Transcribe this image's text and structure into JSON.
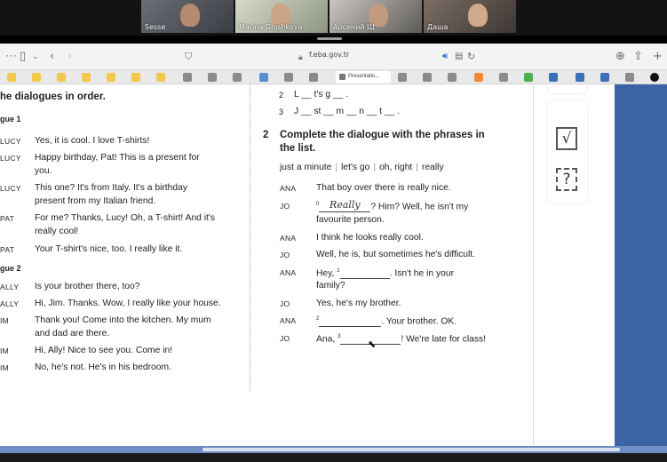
{
  "video": {
    "participants": [
      {
        "name": "Sesse"
      },
      {
        "name": "Marina Glushkova"
      },
      {
        "name": "Арсений Щ"
      },
      {
        "name": "Даша"
      }
    ]
  },
  "browser": {
    "address": "f.eba.gov.tr",
    "active_tab": "Presentatio..."
  },
  "left": {
    "heading": "he dialogues in order.",
    "dialogue1_label": "gue 1",
    "dialogue1": [
      {
        "speaker": "LUCY",
        "text": "Yes, it is cool. I love T-shirts!"
      },
      {
        "speaker": "LUCY",
        "text": "Happy birthday, Pat! This is a present for",
        "text2": "you."
      },
      {
        "speaker": "LUCY",
        "text": "This one? It's from Italy. It's a birthday",
        "text2": "present from my Italian friend."
      },
      {
        "speaker": "PAT",
        "text": "For me? Thanks, Lucy! Oh, a T-shirt! And it's",
        "text2": "really cool!"
      },
      {
        "speaker": "PAT",
        "text": "Your T-shirt's nice, too. I really like it."
      }
    ],
    "dialogue2_label": "gue 2",
    "dialogue2": [
      {
        "speaker": "ALLY",
        "text": "Is your brother there, too?"
      },
      {
        "speaker": "ALLY",
        "text": "Hi, Jim. Thanks. Wow, I really like your house."
      },
      {
        "speaker": "IM",
        "text": "Thank you! Come into the kitchen. My mum",
        "text2": "and dad are there."
      },
      {
        "speaker": "IM",
        "text": "Hi, Ally! Nice to see you. Come in!"
      },
      {
        "speaker": "IM",
        "text": "No, he's not. He's in his bedroom."
      }
    ]
  },
  "right": {
    "item2_num": "2",
    "item2": "L __ t's  g __ .",
    "item3_num": "3",
    "item3": "J __ st  __  m __ n __ t __ .",
    "ex_number": "2",
    "ex_title1": "Complete the dialogue with the phrases in",
    "ex_title2": "the list.",
    "phrases": [
      "just a minute",
      "let's go",
      "oh, right",
      "really"
    ],
    "lines": {
      "l1_speaker": "ANA",
      "l1_text": "That boy over there is really nice.",
      "l2_speaker": "JO",
      "l2_num": "0",
      "l2_answer": "Really",
      "l2_after": "? Him? Well, he isn't my",
      "l2_text2": "favourite person.",
      "l3_speaker": "ANA",
      "l3_text": "I think he looks really cool.",
      "l4_speaker": "JO",
      "l4_text": "Well, he is, but sometimes he's difficult.",
      "l5_speaker": "ANA",
      "l5_before": "Hey,",
      "l5_num": "1",
      "l5_after": ". Isn't he in your",
      "l5_text2": "family?",
      "l6_speaker": "JO",
      "l6_text": "Yes, he's my brother.",
      "l7_speaker": "ANA",
      "l7_num": "2",
      "l7_after": ". Your brother. OK.",
      "l8_speaker": "JO",
      "l8_before": "Ana,",
      "l8_num": "3",
      "l8_after": "! We're late for class!"
    }
  },
  "side_icons": [
    {
      "icon": "check-mark-icon",
      "glyph": "√"
    },
    {
      "icon": "question-mark-icon",
      "glyph": "?"
    }
  ]
}
